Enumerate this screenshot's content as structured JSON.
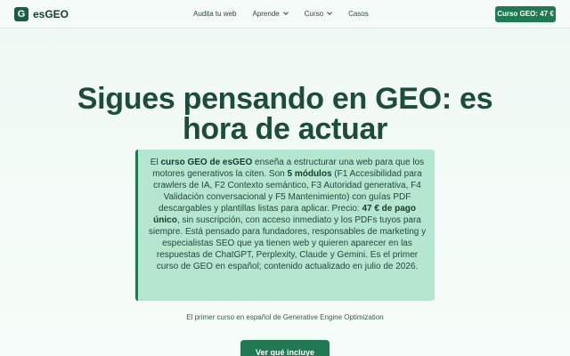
{
  "brand": {
    "logo_letter": "G",
    "name": "esGEO"
  },
  "nav": {
    "links": [
      {
        "label": "Audita tu web"
      },
      {
        "label": "Aprende"
      },
      {
        "label": "Curso"
      },
      {
        "label": "Casos"
      }
    ],
    "cta_label": "Curso GEO: 47 €"
  },
  "hero": {
    "title": "Sigues pensando en GEO: es hora de actuar",
    "description": {
      "p1": "El ",
      "b1": "curso GEO de esGEO",
      "p2": " enseña a estructurar una web para que los motores generativos la citen. Son ",
      "b2": "5 módulos",
      "p3": " (F1 Accesibilidad para crawlers de IA, F2 Contexto semántico, F3 Autoridad generativa, F4 Validación conversacional y F5 Mantenimiento) con guías PDF descargables y plantillas listas para aplicar. Precio: ",
      "b3": "47 € de pago único",
      "p4": ", sin suscripción, con acceso inmediato y los PDFs tuyos para siempre. Está pensado para fundadores, responsables de marketing y especialistas SEO que ya tienen web y quieren aparecer en las respuestas de ChatGPT, Perplexity, Claude y Gemini. Es el primer curso de GEO en español; contenido actualizado en julio de 2026."
    },
    "tagline": "El primer curso en español de Generative Engine Optimization",
    "cta_label": "Ver qué incluye"
  },
  "colors": {
    "accent": "#1f7a53",
    "title": "#1b4d3c",
    "box": "#b5e6d0"
  }
}
